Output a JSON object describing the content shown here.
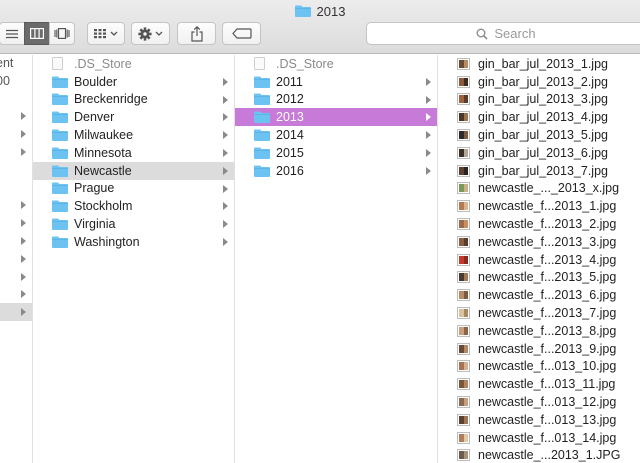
{
  "window": {
    "title": "2013"
  },
  "toolbar": {
    "view_modes": [
      "list-view-icon",
      "column-view-icon",
      "coverflow-view-icon"
    ],
    "active_view": "column-view-icon",
    "arrange_icon": "grid-arrange-icon",
    "action_icon": "gear-icon",
    "share_icon": "share-icon",
    "tag_icon": "tag-icon",
    "search_placeholder": "Search"
  },
  "column1": {
    "items": [
      {
        "label": "ent"
      },
      {
        "label": "00"
      }
    ]
  },
  "column2": {
    "items": [
      {
        "label": ".DS_Store",
        "kind": "file"
      },
      {
        "label": "Boulder",
        "kind": "folder"
      },
      {
        "label": "Breckenridge",
        "kind": "folder"
      },
      {
        "label": "Denver",
        "kind": "folder"
      },
      {
        "label": "Milwaukee",
        "kind": "folder"
      },
      {
        "label": "Minnesota",
        "kind": "folder"
      },
      {
        "label": "Newcastle",
        "kind": "folder",
        "selected": true
      },
      {
        "label": "Prague",
        "kind": "folder"
      },
      {
        "label": "Stockholm",
        "kind": "folder"
      },
      {
        "label": "Virginia",
        "kind": "folder"
      },
      {
        "label": "Washington",
        "kind": "folder"
      }
    ]
  },
  "column3": {
    "items": [
      {
        "label": ".DS_Store",
        "kind": "file"
      },
      {
        "label": "2011",
        "kind": "folder"
      },
      {
        "label": "2012",
        "kind": "folder"
      },
      {
        "label": "2013",
        "kind": "folder",
        "selected": true
      },
      {
        "label": "2014",
        "kind": "folder"
      },
      {
        "label": "2015",
        "kind": "folder"
      },
      {
        "label": "2016",
        "kind": "folder"
      }
    ]
  },
  "column4": {
    "items": [
      {
        "label": "gin_bar_jul_2013_1.jpg"
      },
      {
        "label": "gin_bar_jul_2013_2.jpg"
      },
      {
        "label": "gin_bar_jul_2013_3.jpg"
      },
      {
        "label": "gin_bar_jul_2013_4.jpg"
      },
      {
        "label": "gin_bar_jul_2013_5.jpg"
      },
      {
        "label": "gin_bar_jul_2013_6.jpg"
      },
      {
        "label": "gin_bar_jul_2013_7.jpg"
      },
      {
        "label": "newcastle_..._2013_x.jpg"
      },
      {
        "label": "newcastle_f...2013_1.jpg"
      },
      {
        "label": "newcastle_f...2013_2.jpg"
      },
      {
        "label": "newcastle_f...2013_3.jpg"
      },
      {
        "label": "newcastle_f...2013_4.jpg"
      },
      {
        "label": "newcastle_f...2013_5.jpg"
      },
      {
        "label": "newcastle_f...2013_6.jpg"
      },
      {
        "label": "newcastle_f...2013_7.jpg"
      },
      {
        "label": "newcastle_f...2013_8.jpg"
      },
      {
        "label": "newcastle_f...2013_9.jpg"
      },
      {
        "label": "newcastle_f...013_10.jpg"
      },
      {
        "label": "newcastle_f...013_11.jpg"
      },
      {
        "label": "newcastle_f...013_12.jpg"
      },
      {
        "label": "newcastle_f...013_13.jpg"
      },
      {
        "label": "newcastle_f...013_14.jpg"
      },
      {
        "label": "newcastle_...2013_1.JPG"
      }
    ]
  },
  "colors": {
    "folder": "#6cc3f2",
    "selection_active": "#c87ad8",
    "selection_inactive": "#dcdcdc"
  }
}
